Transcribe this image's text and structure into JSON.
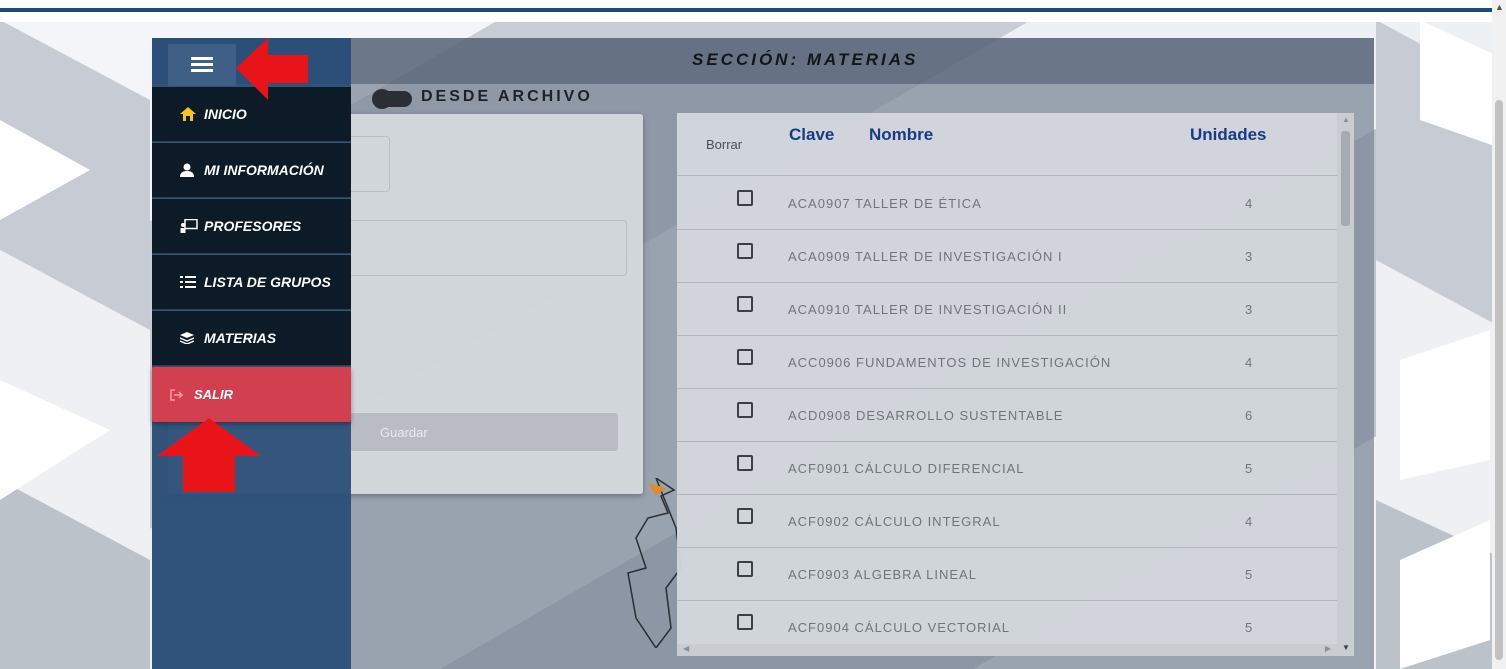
{
  "header": {
    "section_title": "SECCIÓN: MATERIAS"
  },
  "form": {
    "toggle_label": "DESDE ARCHIVO",
    "save_label": "Guardar"
  },
  "sidebar": {
    "items": [
      {
        "label": "INICIO",
        "icon": "home-icon",
        "icon_color": "#f5c518"
      },
      {
        "label": "MI INFORMACIÓN",
        "icon": "user-icon",
        "icon_color": "#ffffff"
      },
      {
        "label": "PROFESORES",
        "icon": "teacher-board-icon",
        "icon_color": "#ffffff"
      },
      {
        "label": "LISTA DE GRUPOS",
        "icon": "list-icon",
        "icon_color": "#ffffff"
      },
      {
        "label": "MATERIAS",
        "icon": "layers-icon",
        "icon_color": "#ffffff"
      },
      {
        "label": "SALIR",
        "icon": "logout-icon",
        "icon_color": "#ff9aa6"
      }
    ]
  },
  "table": {
    "headers": {
      "borrar": "Borrar",
      "clave": "Clave",
      "nombre": "Nombre",
      "unidades": "Unidades"
    },
    "rows": [
      {
        "clave": "ACA0907",
        "nombre": "TALLER DE ÉTICA",
        "unidades": "4"
      },
      {
        "clave": "ACA0909",
        "nombre": "TALLER DE INVESTIGACIÓN I",
        "unidades": "3"
      },
      {
        "clave": "ACA0910",
        "nombre": "TALLER DE INVESTIGACIÓN II",
        "unidades": "3"
      },
      {
        "clave": "ACC0906",
        "nombre": "FUNDAMENTOS DE INVESTIGACIÓN",
        "unidades": "4"
      },
      {
        "clave": "ACD0908",
        "nombre": "DESARROLLO SUSTENTABLE",
        "unidades": "6"
      },
      {
        "clave": "ACF0901",
        "nombre": "CÁLCULO DIFERENCIAL",
        "unidades": "5"
      },
      {
        "clave": "ACF0902",
        "nombre": "CÁLCULO INTEGRAL",
        "unidades": "4"
      },
      {
        "clave": "ACF0903",
        "nombre": "ALGEBRA LINEAL",
        "unidades": "5"
      },
      {
        "clave": "ACF0904",
        "nombre": "CÁLCULO VECTORIAL",
        "unidades": "5"
      }
    ]
  },
  "colors": {
    "sidebar_bg": "#0d1b29",
    "salir_bg": "#d2404f",
    "header_text": "#1b3a86",
    "annotation_arrow": "#e8141a"
  }
}
